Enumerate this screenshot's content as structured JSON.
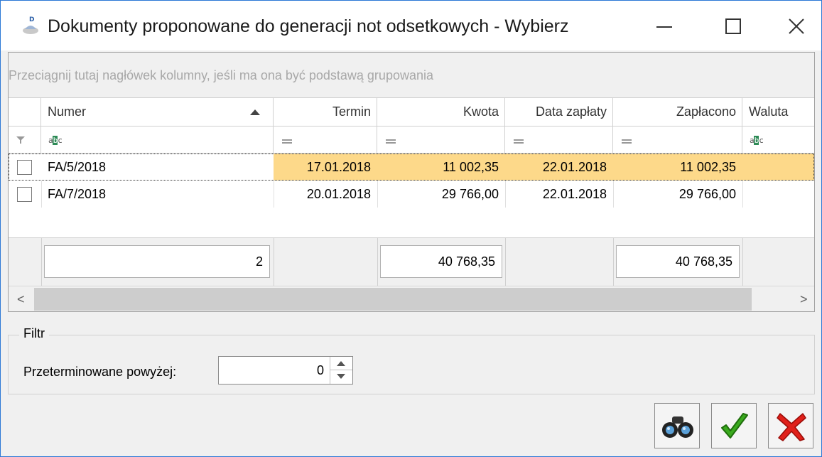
{
  "window": {
    "title": "Dokumenty proponowane do generacji not odsetkowych - Wybierz"
  },
  "grid": {
    "group_hint": "Przeciągnij tutaj nagłówek kolumny, jeśli ma ona być podstawą grupowania",
    "columns": [
      "Numer",
      "Termin",
      "Kwota",
      "Data zapłaty",
      "Zapłacono",
      "Waluta"
    ],
    "rows": [
      {
        "numer": "FA/5/2018",
        "termin": "17.01.2018",
        "kwota": "11 002,35",
        "data_zaplaty": "22.01.2018",
        "zaplacono": "11 002,35",
        "waluta": ""
      },
      {
        "numer": "FA/7/2018",
        "termin": "20.01.2018",
        "kwota": "29 766,00",
        "data_zaplaty": "22.01.2018",
        "zaplacono": "29 766,00",
        "waluta": ""
      }
    ],
    "footer": {
      "count": "2",
      "kwota_sum": "40 768,35",
      "zaplacono_sum": "40 768,35"
    }
  },
  "filter": {
    "legend": "Filtr",
    "label": "Przeterminowane powyżej:",
    "value": "0"
  },
  "colors": {
    "highlight": "#fdd98a",
    "accent": "#2b78d6"
  }
}
